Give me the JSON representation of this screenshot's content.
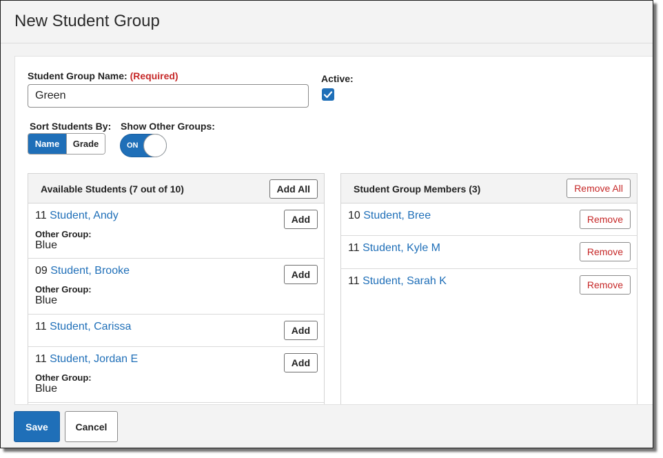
{
  "page_title": "New Student Group",
  "form": {
    "group_name_label": "Student Group Name:",
    "required_text": "(Required)",
    "group_name_value": "Green",
    "active_label": "Active:",
    "active_checked": true,
    "sort_label": "Sort Students By:",
    "sort_options": [
      "Name",
      "Grade"
    ],
    "sort_selected": "Name",
    "show_other_label": "Show Other Groups:",
    "toggle_text": "ON"
  },
  "available": {
    "title": "Available Students (7 out of 10)",
    "add_all_label": "Add All",
    "add_label": "Add",
    "other_group_label": "Other Group:",
    "students": [
      {
        "grade": "11",
        "name": "Student, Andy",
        "other_group": "Blue"
      },
      {
        "grade": "09",
        "name": "Student, Brooke",
        "other_group": "Blue"
      },
      {
        "grade": "11",
        "name": "Student, Carissa",
        "other_group": ""
      },
      {
        "grade": "11",
        "name": "Student, Jordan E",
        "other_group": "Blue"
      }
    ]
  },
  "members": {
    "title": "Student Group Members (3)",
    "remove_all_label": "Remove All",
    "remove_label": "Remove",
    "students": [
      {
        "grade": "10",
        "name": "Student, Bree"
      },
      {
        "grade": "11",
        "name": "Student, Kyle M"
      },
      {
        "grade": "11",
        "name": "Student, Sarah K"
      }
    ]
  },
  "footer": {
    "save_label": "Save",
    "cancel_label": "Cancel"
  },
  "colors": {
    "accent": "#1f6fb8",
    "danger": "#c62828"
  },
  "icons": {
    "active_checkbox": "checkmark-icon"
  }
}
